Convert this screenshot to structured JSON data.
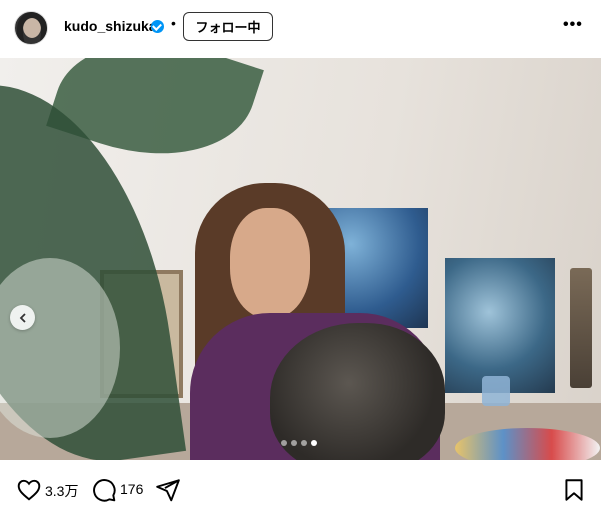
{
  "header": {
    "username": "kudo_shizuka",
    "separator": "•",
    "follow_label": "フォロー中",
    "more": "•••"
  },
  "actions": {
    "likes": "3.3万",
    "comments": "176"
  },
  "icons": {
    "verified": "verified-badge-icon",
    "like": "heart-icon",
    "comment": "comment-icon",
    "share": "send-icon",
    "save": "bookmark-icon"
  },
  "colors": {
    "verified": "#0095f6",
    "text": "#000000"
  },
  "carousel": {
    "slides": 4,
    "active_index": 4
  }
}
